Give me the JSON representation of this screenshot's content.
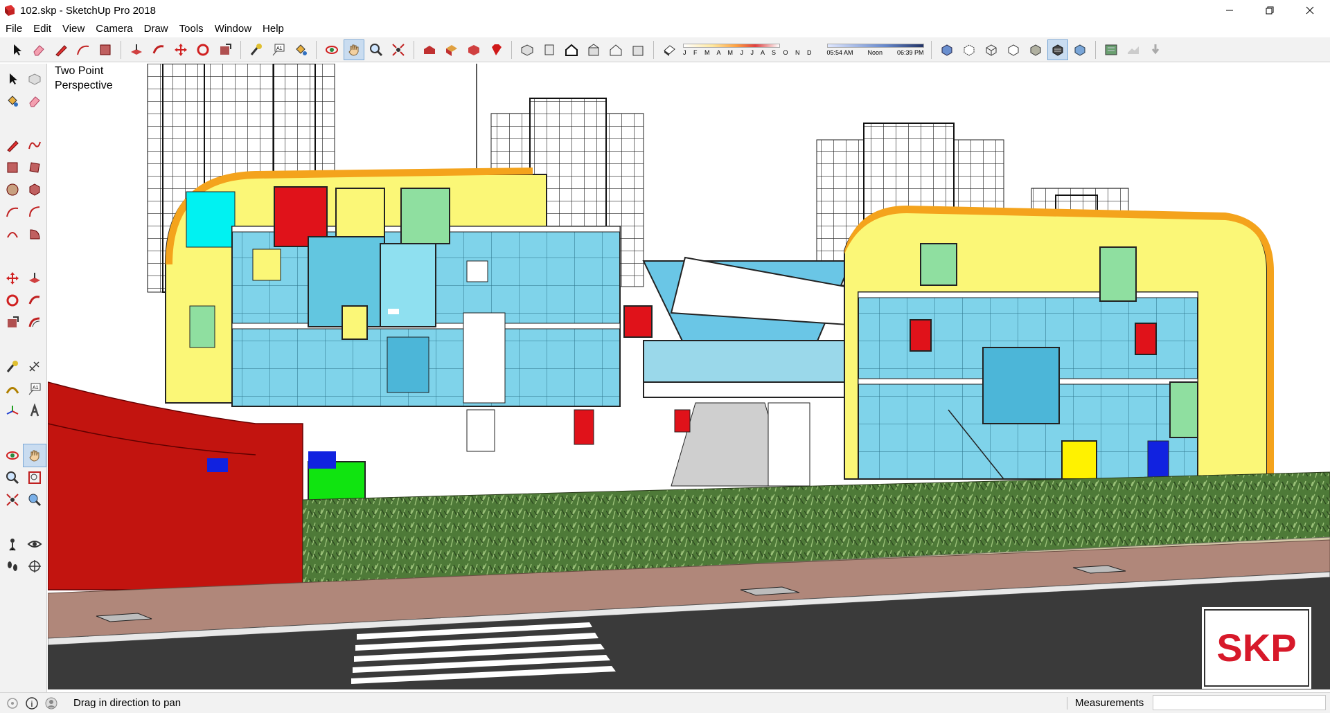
{
  "window": {
    "title": "102.skp - SketchUp Pro 2018"
  },
  "menu": [
    "File",
    "Edit",
    "View",
    "Camera",
    "Draw",
    "Tools",
    "Window",
    "Help"
  ],
  "toolbar": {
    "months": "J F M A M J J A S O N D",
    "time_start": "05:54 AM",
    "time_mid": "Noon",
    "time_end": "06:39 PM"
  },
  "viewport": {
    "camera_label_line1": "Two Point",
    "camera_label_line2": "Perspective"
  },
  "logo": {
    "text": "SKP",
    "color": "#d7192a"
  },
  "status": {
    "hint": "Drag in direction to pan",
    "measurements_label": "Measurements",
    "measurements_value": ""
  },
  "colors": {
    "accent": "#2a70c8",
    "panel_yellow": "#fbf777",
    "glass": "#7ed6ec",
    "red": "#e0121a"
  }
}
